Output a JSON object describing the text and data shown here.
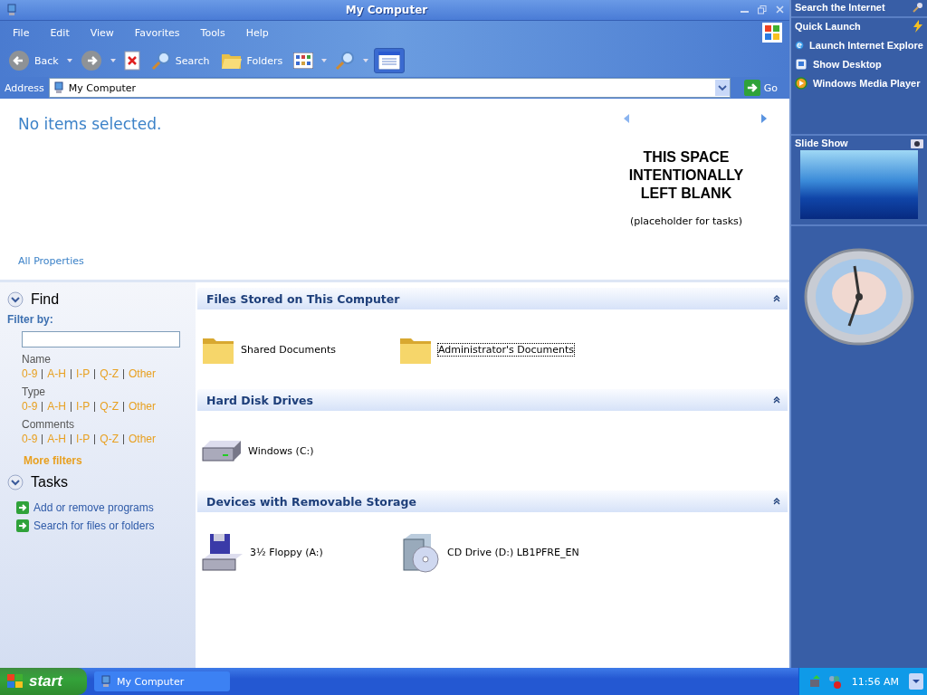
{
  "window": {
    "title": "My Computer"
  },
  "menu": [
    "File",
    "Edit",
    "View",
    "Favorites",
    "Tools",
    "Help"
  ],
  "toolbar": [
    {
      "kind": "back",
      "label": "Back",
      "pressed": false
    },
    {
      "kind": "forward",
      "pressed": false
    },
    {
      "kind": "stop",
      "pressed": false
    },
    {
      "kind": "search",
      "label": "Search",
      "pressed": false
    },
    {
      "kind": "folders",
      "label": "Folders",
      "pressed": false
    },
    {
      "kind": "views",
      "pressed": false
    },
    {
      "kind": "zoom",
      "pressed": false
    },
    {
      "kind": "preview",
      "pressed": true
    }
  ],
  "address": {
    "label": "Address",
    "value": "My Computer",
    "go": "Go"
  },
  "info": {
    "status": "No items selected.",
    "link": "All Properties",
    "notice": "THIS SPACE INTENTIONALLY LEFT BLANK",
    "note": "(placeholder for tasks)"
  },
  "find": {
    "title": "Find",
    "filter_label": "Filter by:",
    "filters": [
      {
        "name": "Name",
        "options": [
          "0-9",
          "A-H",
          "I-P",
          "Q-Z",
          "Other"
        ]
      },
      {
        "name": "Type",
        "options": [
          "0-9",
          "A-H",
          "I-P",
          "Q-Z",
          "Other"
        ]
      },
      {
        "name": "Comments",
        "options": [
          "0-9",
          "A-H",
          "I-P",
          "Q-Z",
          "Other"
        ]
      }
    ],
    "more": "More filters"
  },
  "tasks": {
    "title": "Tasks",
    "items": [
      "Add or remove programs",
      "Search for files or folders"
    ]
  },
  "groups": [
    {
      "title": "Files Stored on This Computer",
      "items": [
        {
          "kind": "folder",
          "label": "Shared Documents",
          "selected": false
        },
        {
          "kind": "folder",
          "label": "Administrator's Documents",
          "selected": true
        }
      ]
    },
    {
      "title": "Hard Disk Drives",
      "items": [
        {
          "kind": "harddisk",
          "label": "Windows (C:)",
          "selected": false
        }
      ]
    },
    {
      "title": "Devices with Removable Storage",
      "items": [
        {
          "kind": "floppy",
          "label": "3½ Floppy (A:)",
          "selected": false
        },
        {
          "kind": "cdrom",
          "label": "CD Drive (D:) LB1PFRE_EN",
          "selected": false
        }
      ]
    }
  ],
  "sidebar": {
    "search_title": "Search the Internet",
    "quick_launch": {
      "title": "Quick Launch",
      "items": [
        {
          "kind": "browser",
          "label": "Launch Internet Explore"
        },
        {
          "kind": "desktop",
          "label": "Show Desktop"
        },
        {
          "kind": "media",
          "label": "Windows Media Player"
        }
      ]
    },
    "slideshow": {
      "title": "Slide Show"
    }
  },
  "taskbar": {
    "start": "start",
    "tasks": [
      "My Computer"
    ],
    "clock": "11:56 AM"
  }
}
